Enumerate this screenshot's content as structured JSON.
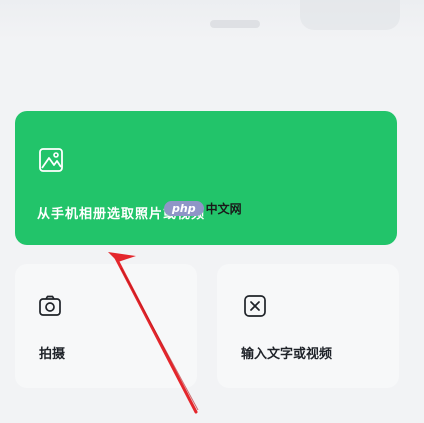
{
  "album_card": {
    "label": "从手机相册选取照片或视频",
    "icon": "image-icon",
    "color": "#22c46a"
  },
  "watermark": {
    "oval_text": "php",
    "site_text": "中文网"
  },
  "tiles": [
    {
      "label": "拍摄",
      "icon": "camera-icon"
    },
    {
      "label": "输入文字或视频",
      "icon": "text-input-icon"
    }
  ],
  "annotation": {
    "arrow_color": "#e4262c"
  }
}
